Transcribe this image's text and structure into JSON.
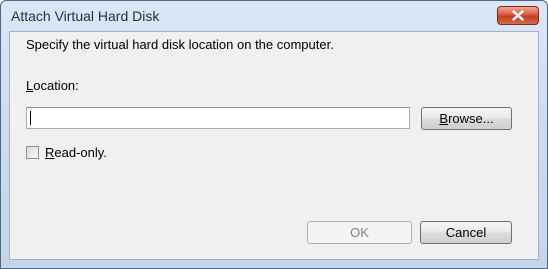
{
  "window": {
    "title": "Attach Virtual Hard Disk"
  },
  "icons": {
    "close": "close-icon"
  },
  "dialog": {
    "instruction": "Specify the virtual hard disk location on the computer.",
    "location_label_key": "L",
    "location_label_rest": "ocation:",
    "location_value": "",
    "browse_key": "B",
    "browse_rest": "rowse...",
    "readonly_key": "R",
    "readonly_rest": "ead-only.",
    "readonly_checked": false,
    "ok_label": "OK",
    "ok_enabled": false,
    "cancel_label": "Cancel"
  },
  "colors": {
    "close_button": "#c23c1f",
    "client_background": "#f0f0f0",
    "disabled_text": "#838383"
  }
}
